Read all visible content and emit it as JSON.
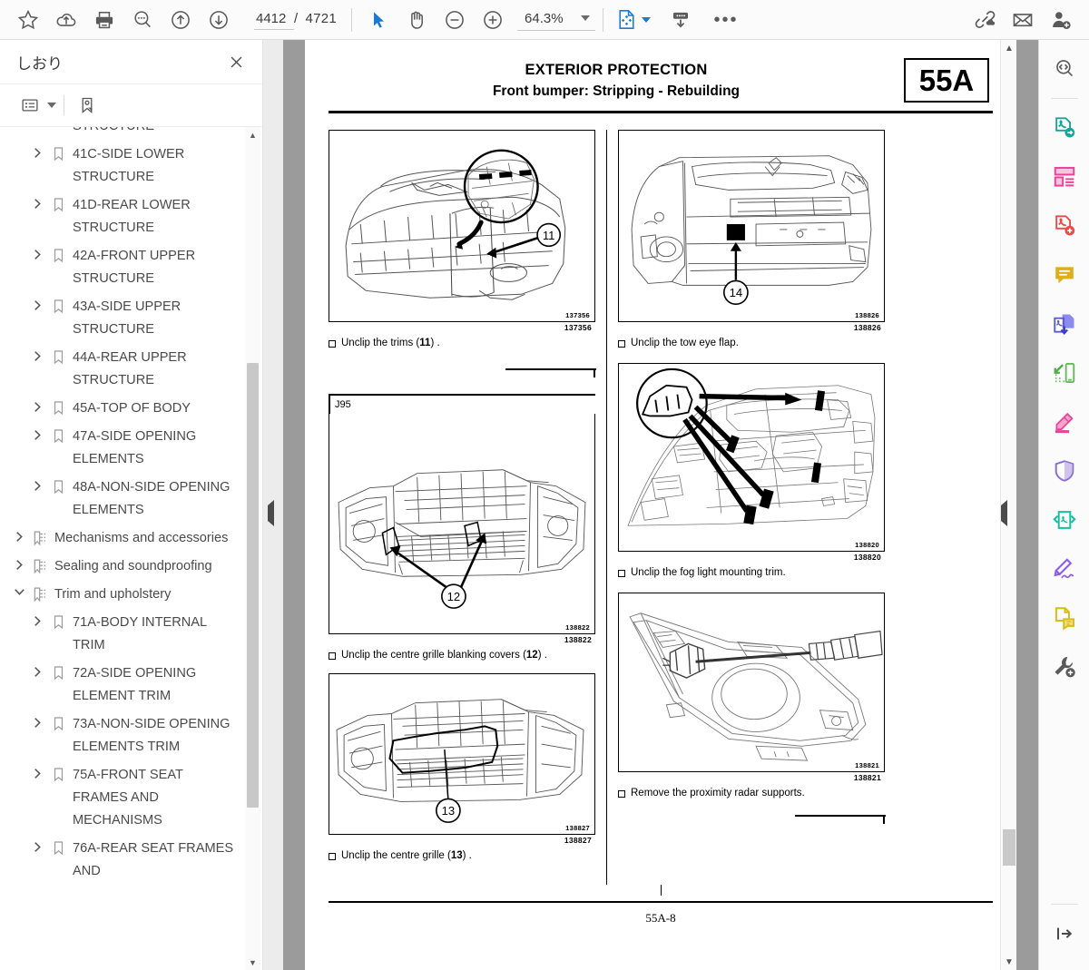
{
  "toolbar": {
    "left_buttons": [
      {
        "name": "favorite-icon",
        "label": "Favorite"
      },
      {
        "name": "cloud-upload-icon",
        "label": "Upload to cloud"
      },
      {
        "name": "print-icon",
        "label": "Print"
      },
      {
        "name": "search-icon",
        "label": "Search"
      },
      {
        "name": "page-up-icon",
        "label": "Previous page"
      },
      {
        "name": "page-down-icon",
        "label": "Next page"
      }
    ],
    "page_current": "4412",
    "page_separator": "/",
    "page_total": "4721",
    "select_tool": "Select",
    "pan_tool": "Pan",
    "zoom_out": "Zoom out",
    "zoom_in": "Zoom in",
    "zoom_value": "64.3%",
    "fit_tool": "Fit page",
    "snapshot_tool": "Snapshot",
    "more_label": "•••",
    "right_buttons": [
      {
        "name": "link-cloud-icon",
        "label": "Share link"
      },
      {
        "name": "email-icon",
        "label": "Email"
      },
      {
        "name": "add-user-icon",
        "label": "Add user"
      }
    ]
  },
  "sidebar": {
    "title": "しおり",
    "close_label": "✕",
    "tool_options_label": "Options",
    "tool_bookmark_label": "New bookmark",
    "items": [
      {
        "label": "STRUCTURE",
        "level": 2,
        "twisty": "none",
        "icon": "bookmark-icon",
        "clipped": true
      },
      {
        "label": "41C-SIDE LOWER STRUCTURE",
        "level": 2,
        "twisty": "collapsed",
        "icon": "bookmark-icon"
      },
      {
        "label": "41D-REAR LOWER STRUCTURE",
        "level": 2,
        "twisty": "collapsed",
        "icon": "bookmark-icon"
      },
      {
        "label": "42A-FRONT UPPER STRUCTURE",
        "level": 2,
        "twisty": "collapsed",
        "icon": "bookmark-icon"
      },
      {
        "label": "43A-SIDE UPPER STRUCTURE",
        "level": 2,
        "twisty": "collapsed",
        "icon": "bookmark-icon"
      },
      {
        "label": "44A-REAR UPPER STRUCTURE",
        "level": 2,
        "twisty": "collapsed",
        "icon": "bookmark-icon"
      },
      {
        "label": "45A-TOP OF BODY",
        "level": 2,
        "twisty": "collapsed",
        "icon": "bookmark-icon"
      },
      {
        "label": "47A-SIDE OPENING ELEMENTS",
        "level": 2,
        "twisty": "collapsed",
        "icon": "bookmark-icon"
      },
      {
        "label": "48A-NON-SIDE OPENING ELEMENTS",
        "level": 2,
        "twisty": "collapsed",
        "icon": "bookmark-icon"
      },
      {
        "label": "Mechanisms and accessories",
        "level": 1,
        "twisty": "collapsed",
        "icon": "bookmark-folder-icon"
      },
      {
        "label": "Sealing and soundproofing",
        "level": 1,
        "twisty": "collapsed",
        "icon": "bookmark-folder-icon"
      },
      {
        "label": "Trim and upholstery",
        "level": 1,
        "twisty": "expanded",
        "icon": "bookmark-folder-icon"
      },
      {
        "label": "71A-BODY INTERNAL TRIM",
        "level": 2,
        "twisty": "collapsed",
        "icon": "bookmark-icon"
      },
      {
        "label": "72A-SIDE OPENING ELEMENT TRIM",
        "level": 2,
        "twisty": "collapsed",
        "icon": "bookmark-icon"
      },
      {
        "label": "73A-NON-SIDE OPENING ELEMENTS TRIM",
        "level": 2,
        "twisty": "collapsed",
        "icon": "bookmark-icon"
      },
      {
        "label": "75A-FRONT SEAT FRAMES AND MECHANISMS",
        "level": 2,
        "twisty": "collapsed",
        "icon": "bookmark-icon"
      },
      {
        "label": "76A-REAR SEAT FRAMES AND",
        "level": 2,
        "twisty": "collapsed",
        "icon": "bookmark-icon"
      }
    ]
  },
  "document": {
    "header_title": "EXTERIOR PROTECTION",
    "header_subtitle": "Front bumper: Stripping - Rebuilding",
    "header_code": "55A",
    "variant_tag": "J95",
    "footer_page": "55A-8",
    "left_column": [
      {
        "figure_id": "137356",
        "caption_prefix": "Unclip the trims (",
        "caption_ref": "11",
        "caption_suffix": ") .",
        "callout": "11"
      },
      {
        "figure_id": "138822",
        "caption_prefix": "Unclip the centre grille blanking covers (",
        "caption_ref": "12",
        "caption_suffix": ") .",
        "callout": "12"
      },
      {
        "figure_id": "138827",
        "caption_prefix": "Unclip the centre grille (",
        "caption_ref": "13",
        "caption_suffix": ") .",
        "callout": "13"
      }
    ],
    "right_column": [
      {
        "figure_id": "138826",
        "caption_prefix": "Unclip the tow eye flap.",
        "caption_ref": "",
        "caption_suffix": "",
        "callout": "14"
      },
      {
        "figure_id": "138820",
        "caption_prefix": "Unclip the fog light mounting trim.",
        "caption_ref": "",
        "caption_suffix": "",
        "callout": ""
      },
      {
        "figure_id": "138821",
        "caption_prefix": "Remove the proximity radar supports.",
        "caption_ref": "",
        "caption_suffix": "",
        "callout": ""
      }
    ]
  },
  "rail": {
    "items": [
      {
        "name": "find-icon",
        "label": "Find",
        "color": "#5a5a5a"
      },
      {
        "name": "convert-pdf-icon",
        "label": "Convert PDF",
        "color": "#18a39b"
      },
      {
        "name": "organize-pages-icon",
        "label": "Organize pages",
        "color": "#e8449a"
      },
      {
        "name": "create-pdf-icon",
        "label": "Create PDF",
        "color": "#ec4b4b"
      },
      {
        "name": "comment-icon",
        "label": "Comment",
        "color": "#e0ae16"
      },
      {
        "name": "export-pdf-icon",
        "label": "Export PDF",
        "color": "#5b5bd6"
      },
      {
        "name": "mobile-link-icon",
        "label": "Send to mobile",
        "color": "#5fbf52"
      },
      {
        "name": "highlight-icon",
        "label": "Highlight",
        "color": "#e8449a"
      },
      {
        "name": "protect-icon",
        "label": "Protect",
        "color": "#8a6fd6"
      },
      {
        "name": "compress-pdf-icon",
        "label": "Compress PDF",
        "color": "#18bfa0"
      },
      {
        "name": "fill-sign-icon",
        "label": "Fill & Sign",
        "color": "#8b5cf0"
      },
      {
        "name": "stamp-icon",
        "label": "Stamp",
        "color": "#d8bd19"
      },
      {
        "name": "tools-icon",
        "label": "More tools",
        "color": "#5a5a5a"
      }
    ],
    "collapse_label": "Collapse panel"
  }
}
